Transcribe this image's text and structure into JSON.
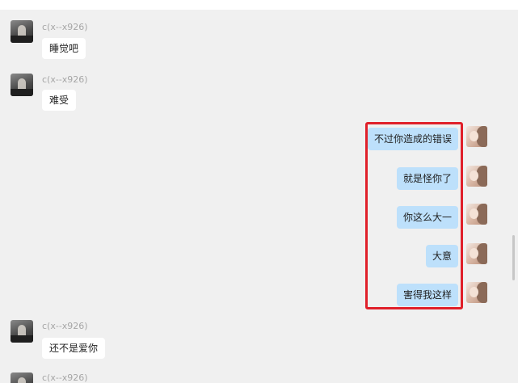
{
  "messages": {
    "m1": {
      "sender": "c(x--x926)",
      "text": "睡觉吧"
    },
    "m2": {
      "sender": "c(x--x926)",
      "text": "难受"
    },
    "r1": {
      "text": "不过你造成的错误"
    },
    "r2": {
      "text": "就是怪你了"
    },
    "r3": {
      "text": "你这么大一"
    },
    "r4": {
      "text": "大意"
    },
    "r5": {
      "text": "害得我这样"
    },
    "m3": {
      "sender": "c(x--x926)",
      "text": "还不是爱你"
    },
    "m4": {
      "sender": "c(x--x926)"
    }
  },
  "colors": {
    "chat_background": "#f0f0f0",
    "outgoing_bubble": "#bde0fb",
    "incoming_bubble": "#ffffff",
    "highlight_border": "#e0202a"
  }
}
